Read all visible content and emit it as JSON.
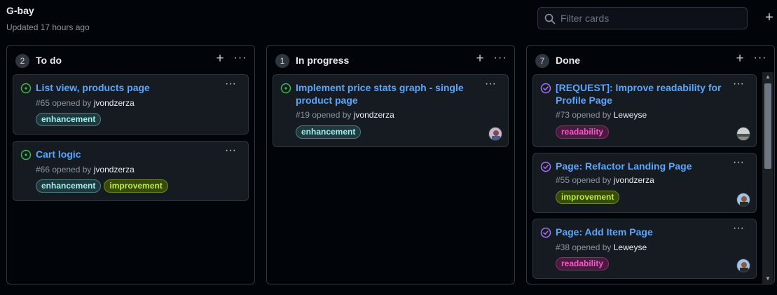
{
  "project": {
    "title": "G-bay",
    "updated": "Updated 17 hours ago"
  },
  "filter": {
    "placeholder": "Filter cards",
    "value": ""
  },
  "toolbar": {
    "add_column_glyph": "+"
  },
  "icons": {
    "search": "search-icon",
    "open_issue": "issue-opened-icon",
    "closed_issue": "issue-closed-icon",
    "add": "plus-icon",
    "more": "kebab-horizontal-icon"
  },
  "colors": {
    "link": "#58a6ff",
    "open_state": "#3fb950",
    "closed_state": "#a371f7",
    "background": "#010409",
    "card": "#161b22",
    "border": "#30363d"
  },
  "columns": [
    {
      "count": "2",
      "name": "To do",
      "add_glyph": "+",
      "more_glyph": "···",
      "cards": [
        {
          "state": "open",
          "title": "List view, products page",
          "number_text": "#65 opened by ",
          "author": "jvondzerza",
          "labels": [
            "enhancement"
          ],
          "more_glyph": "···",
          "avatar": false
        },
        {
          "state": "open",
          "title": "Cart logic",
          "number_text": "#66 opened by ",
          "author": "jvondzerza",
          "labels": [
            "enhancement",
            "improvement"
          ],
          "more_glyph": "···",
          "avatar": false
        }
      ]
    },
    {
      "count": "1",
      "name": "In progress",
      "add_glyph": "+",
      "more_glyph": "···",
      "cards": [
        {
          "state": "open",
          "title_line1": "Implement price stats graph - single",
          "title_line2": "product page",
          "number_text": "#19 opened by ",
          "author": "jvondzerza",
          "labels": [
            "enhancement"
          ],
          "more_glyph": "···",
          "avatar": true
        }
      ]
    },
    {
      "count": "7",
      "name": "Done",
      "add_glyph": "+",
      "more_glyph": "···",
      "cards": [
        {
          "state": "closed",
          "title_line1": "[REQUEST]: Improve readability for",
          "title_line2": "Profile Page",
          "number_text": "#73 opened by ",
          "author": "Leweyse",
          "labels": [
            "readability"
          ],
          "more_glyph": "···",
          "avatar": true
        },
        {
          "state": "closed",
          "title": "Page: Refactor Landing Page",
          "number_text": "#55 opened by ",
          "author": "jvondzerza",
          "labels": [
            "improvement"
          ],
          "more_glyph": "···",
          "avatar": true
        },
        {
          "state": "closed",
          "title": "Page: Add Item Page",
          "number_text": "#38 opened by ",
          "author": "Leweyse",
          "labels": [
            "readability"
          ],
          "more_glyph": "···",
          "avatar": true
        }
      ]
    }
  ],
  "scrollbar": {
    "up_glyph": "▲",
    "down_glyph": "▼"
  }
}
